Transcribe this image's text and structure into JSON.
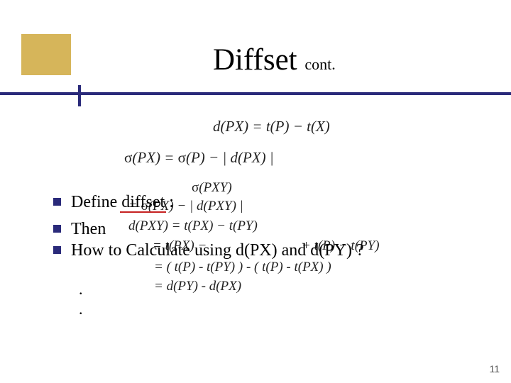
{
  "title": {
    "main": "Diffset",
    "sub": "cont."
  },
  "formulas": {
    "def": "d(PX) = t(P) − t(X)",
    "sigmaPX": "σ(PX) = σ(P) − | d(PX) |",
    "sigmaPXY": "σ(PXY)",
    "sigmaPXY2": "= σ(PX) − | d(PXY) |",
    "dPXY": "d(PXY) = t(PX) − t(PY)",
    "lineA_l": "= t(PX) −",
    "lineA_r": "+ t(P) − t(PY)",
    "lineB": "= ( t(P) - t(PY) ) - ( t(P) - t(PX) )",
    "lineC": "= d(PY) - d(PX)"
  },
  "bullets": {
    "define_pre": "Define ",
    "define_word": "diffset",
    "define_post": " :",
    "then": "Then",
    "how": "How to Calculate                 using d(PX) and d(PY) ?"
  },
  "page_number": "11"
}
